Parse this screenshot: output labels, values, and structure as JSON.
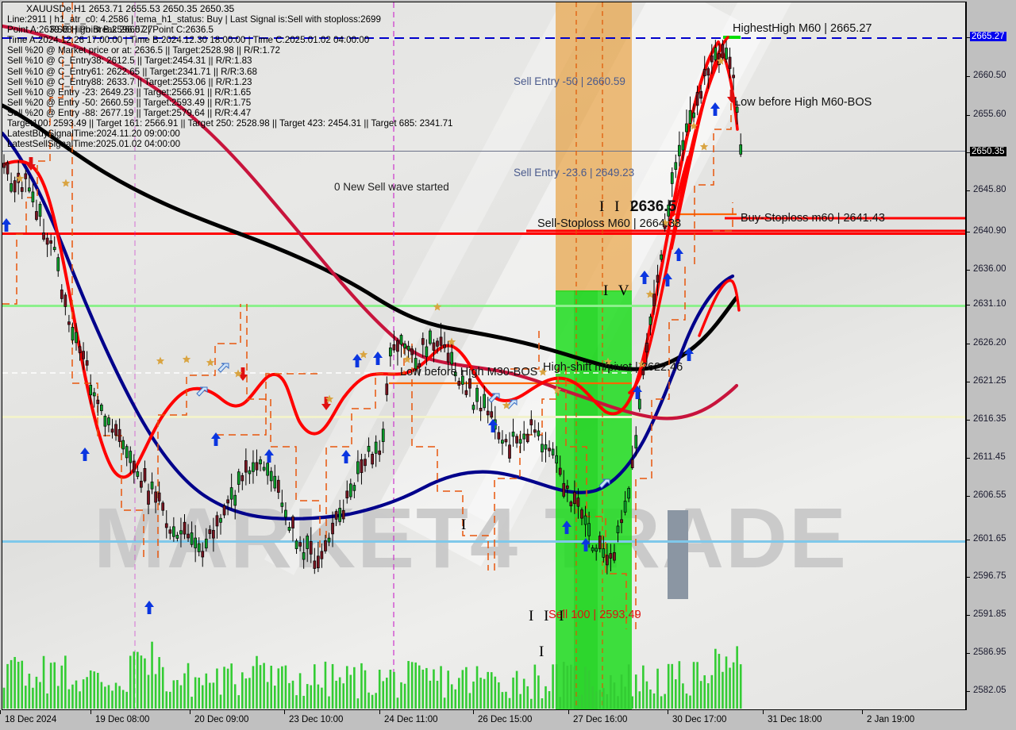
{
  "symbol_header": {
    "title": "XAUUSDe,H1  2653.71 2655.53 2650.35 2650.35",
    "lines": [
      "Line:2911 | h1_atr_c0: 4.2586 | tema_h1_status: Buy | Last Signal is:Sell with stoploss:2699",
      "Point A:2639.08 | Point B:2596.07 | Point C:2636.5",
      "Time A:2024.12.26 17:00:00 | Time B:2024.12.30 18:00:00 | Time C:2025.01.02 04:00:00",
      "Sell %20 @ Market price or at: 2636.5 || Target:2528.98 || R/R:1.72",
      "Sell %10 @ C_Entry38: 2612.5 || Target:2454.31 || R/R:1.83",
      "Sell %10 @ C_Entry61: 2622.65 || Target:2341.71 || R/R:3.68",
      "Sell %10 @ C_Entry88: 2633.7 || Target:2553.06 || R/R:1.23",
      "Sell %10 @ Entry -23: 2649.23 || Target:2566.91 || R/R:1.65",
      "Sell %20 @ Entry -50: 2660.59 || Target:2593.49 || R/R:1.75",
      "Sell %20 @ Entry -88: 2677.19 || Target:2579.64 || R/R:4.47",
      "Target100: 2593.49 || Target 161: 2566.91 || Target 250: 2528.98 || Target 423: 2454.31 || Target 685: 2341.71",
      "LatestBuySignalTime:2024.11.20 09:00:00",
      "LatestSellSignalTime:2025.01.02 04:00:00"
    ],
    "overlay_line": "RSB High Break  2665.27"
  },
  "watermark": {
    "text": "MARKET4 TRADE"
  },
  "annotations": {
    "highest_high": "HighestHigh    M60 | 2665.27",
    "sell_entry_50": "Sell Entry -50 | 2660.59",
    "low_before_high_m60": "Low before High    M60-BOS",
    "sell_entry_236": "Sell Entry -23.6 | 2649.23",
    "sell_stoploss_m60": "Sell-Stoploss M60 | 2664.38",
    "buy_stoploss_m60": "Buy-Stoploss m60 | 2641.43",
    "price_tag_2636": "2636.5",
    "new_sell_wave": "0 New Sell wave started",
    "low_before_high_m30": "Low before High  M30-BOS",
    "high_shift_pivot": "High-shift m/pivot | 2622.46",
    "sell_100": "Sell 100 | 2593.49",
    "wave_iii_top": "I I I",
    "wave_iv": "I V",
    "wave_i": "I",
    "wave_iii_bottom": "I I I",
    "wave_i_bottom": "I"
  },
  "price_axis": {
    "current_price": "2650.35",
    "highlight_price": "2665.27",
    "labels": [
      "2665.27",
      "2660.50",
      "2655.60",
      "2650.35",
      "2645.80",
      "2640.90",
      "2636.00",
      "2631.10",
      "2626.20",
      "2621.25",
      "2616.35",
      "2611.45",
      "2606.55",
      "2601.65",
      "2596.75",
      "2591.85",
      "2586.95",
      "2582.05"
    ]
  },
  "time_axis": {
    "labels": [
      "18 Dec 2024",
      "19 Dec 08:00",
      "20 Dec 09:00",
      "23 Dec 10:00",
      "24 Dec 11:00",
      "26 Dec 15:00",
      "27 Dec 16:00",
      "30 Dec 17:00",
      "31 Dec 18:00",
      "2 Jan 19:00"
    ]
  },
  "colors": {
    "bull_candle": "#0aa02a",
    "bear_candle": "#7a1420",
    "fast_ma": "#ff0000",
    "slow_ma": "#000000",
    "blue_ma": "#00008b",
    "crimson_ma": "#c8143c",
    "stoploss_line": "#ff0000",
    "bos_line": "#ff6600",
    "highest_high_line": "#0000cc",
    "green_level": "#8cf08c",
    "cyan_level": "#7fc8ea",
    "yellow_level": "#f2f2cc",
    "zone_orange": "#e68c14",
    "zone_green": "#1edc1e",
    "volume": "#33cc33"
  },
  "chart_data": {
    "type": "candlestick",
    "title": "XAUUSDe,H1",
    "ohlc_header": {
      "open": 2653.71,
      "high": 2655.53,
      "low": 2650.35,
      "close": 2650.35
    },
    "ylim": [
      2580.0,
      2667.5
    ],
    "y_ticks": [
      2665.27,
      2660.5,
      2655.6,
      2650.35,
      2645.8,
      2640.9,
      2636.0,
      2631.1,
      2626.2,
      2621.25,
      2616.35,
      2611.45,
      2606.55,
      2601.65,
      2596.75,
      2591.85,
      2586.95,
      2582.05
    ],
    "x_ticks": [
      "18 Dec 2024",
      "19 Dec 08:00",
      "20 Dec 09:00",
      "23 Dec 10:00",
      "24 Dec 11:00",
      "26 Dec 15:00",
      "27 Dec 16:00",
      "30 Dec 17:00",
      "31 Dec 18:00",
      "2 Jan 19:00"
    ],
    "levels": [
      {
        "name": "HighestHigh M60",
        "value": 2665.27,
        "color": "#0000cc",
        "style": "dashed"
      },
      {
        "name": "Sell-Stoploss M60",
        "value": 2664.38,
        "color": "#ff0000",
        "style": "solid"
      },
      {
        "name": "Buy-Stoploss m60",
        "value": 2641.43,
        "color": "#ff0000",
        "style": "solid"
      },
      {
        "name": "Current price",
        "value": 2650.35,
        "color": "#555577",
        "style": "solid"
      },
      {
        "name": "Green level",
        "value": 2631.1,
        "color": "#8cf08c",
        "style": "solid"
      },
      {
        "name": "Yellow level",
        "value": 2616.4,
        "color": "#f2f2cc",
        "style": "solid"
      },
      {
        "name": "Cyan level",
        "value": 2601.65,
        "color": "#7fc8ea",
        "style": "solid"
      },
      {
        "name": "High-shift m/pivot",
        "value": 2622.46,
        "color": "#ff6600",
        "style": "solid"
      }
    ],
    "entries": [
      {
        "label": "Sell %20 @ Market price",
        "entry": 2636.5,
        "target": 2528.98,
        "rr": 1.72
      },
      {
        "label": "Sell %10 @ C_Entry38",
        "entry": 2612.5,
        "target": 2454.31,
        "rr": 1.83
      },
      {
        "label": "Sell %10 @ C_Entry61",
        "entry": 2622.65,
        "target": 2341.71,
        "rr": 3.68
      },
      {
        "label": "Sell %10 @ C_Entry88",
        "entry": 2633.7,
        "target": 2553.06,
        "rr": 1.23
      },
      {
        "label": "Sell %10 @ Entry -23",
        "entry": 2649.23,
        "target": 2566.91,
        "rr": 1.65
      },
      {
        "label": "Sell %20 @ Entry -50",
        "entry": 2660.59,
        "target": 2593.49,
        "rr": 1.75
      },
      {
        "label": "Sell %20 @ Entry -88",
        "entry": 2677.19,
        "target": 2579.64,
        "rr": 4.47
      }
    ],
    "targets": {
      "t100": 2593.49,
      "t161": 2566.91,
      "t250": 2528.98,
      "t423": 2454.31,
      "t685": 2341.71
    },
    "abc_points": {
      "A": 2639.08,
      "B": 2596.07,
      "C": 2636.5
    },
    "abc_times": {
      "A": "2024.12.26 17:00:00",
      "B": "2024.12.30 18:00:00",
      "C": "2025.01.02 04:00:00"
    },
    "indicators": [
      "fast MA (red)",
      "slow MA (black)",
      "blue MA",
      "crimson MA",
      "dashed orange channel",
      "volume"
    ]
  }
}
